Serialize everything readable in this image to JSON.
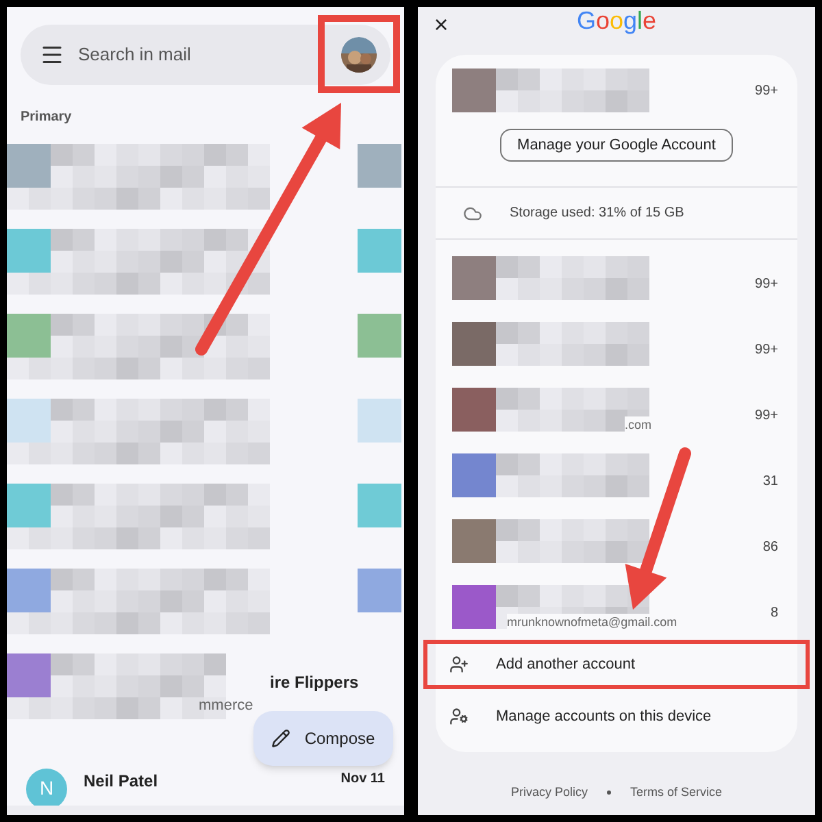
{
  "inbox": {
    "search": {
      "placeholder": "Search in mail",
      "avatar_highlighted": true
    },
    "section_label": "Primary",
    "emails": [
      {
        "kind": "redacted",
        "color": "#9fb0bd"
      },
      {
        "kind": "redacted",
        "color": "#6cc9d6"
      },
      {
        "kind": "redacted",
        "color": "#8cbf94"
      },
      {
        "kind": "redacted",
        "color": "#cfe3f2"
      },
      {
        "kind": "redacted",
        "color": "#6fcbd6"
      },
      {
        "kind": "redacted",
        "color": "#8fa9e0"
      },
      {
        "kind": "partial",
        "color": "#9b7fd1",
        "sender": "ire Flippers",
        "snippet": "mmerce"
      },
      {
        "kind": "message",
        "sender": "Neil Patel",
        "date": "Nov 11",
        "initial": "N"
      }
    ],
    "compose": {
      "label": "Compose"
    }
  },
  "accounts_dialog": {
    "close": "×",
    "logo": "Google",
    "current_account": {
      "count": "99+"
    },
    "manage_button": "Manage your Google Account",
    "storage": "Storage used: 31% of 15 GB",
    "accounts": [
      {
        "count": "99+",
        "color": "#8e7f7f"
      },
      {
        "count": "99+",
        "color": "#7a6a66"
      },
      {
        "count": "99+",
        "color": "#8a5f5f",
        "email_fragment": ".com"
      },
      {
        "count": "31",
        "color": "#7486cf"
      },
      {
        "count": "86",
        "color": "#8a7a70"
      },
      {
        "count": "8",
        "color": "#9b59c9",
        "email_fragment": "mrunknownofmeta@gmail.com"
      }
    ],
    "actions": [
      {
        "kind": "add",
        "label": "Add another account",
        "highlighted": true
      },
      {
        "kind": "manage",
        "label": "Manage accounts on this device",
        "highlighted": false
      }
    ],
    "footer": [
      {
        "label": "Privacy Policy"
      },
      {
        "label": "Terms of Service"
      }
    ]
  }
}
